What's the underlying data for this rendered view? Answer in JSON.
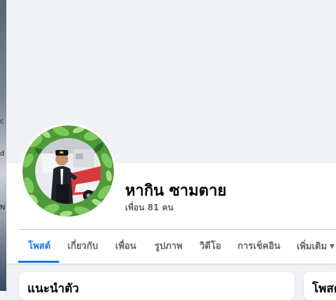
{
  "profile": {
    "name": "หากิน ซามตาย",
    "friends_summary": "เพื่อน 81 คน"
  },
  "tabs": [
    {
      "label": "โพสต์",
      "active": true
    },
    {
      "label": "เกี่ยวกับ",
      "active": false
    },
    {
      "label": "เพื่อน",
      "active": false
    },
    {
      "label": "รูปภาพ",
      "active": false
    },
    {
      "label": "วิดีโอ",
      "active": false
    },
    {
      "label": "การเช็คอิน",
      "active": false
    },
    {
      "label": "เพิ่มเติม",
      "active": false,
      "icon": "chevron-down-icon"
    }
  ],
  "cards": {
    "intro_title": "แนะนำตัว",
    "posts_title": "โพสต์"
  },
  "colors": {
    "accent": "#1877f2",
    "muted_text": "#65676b",
    "page_bg": "#f0f2f5"
  }
}
